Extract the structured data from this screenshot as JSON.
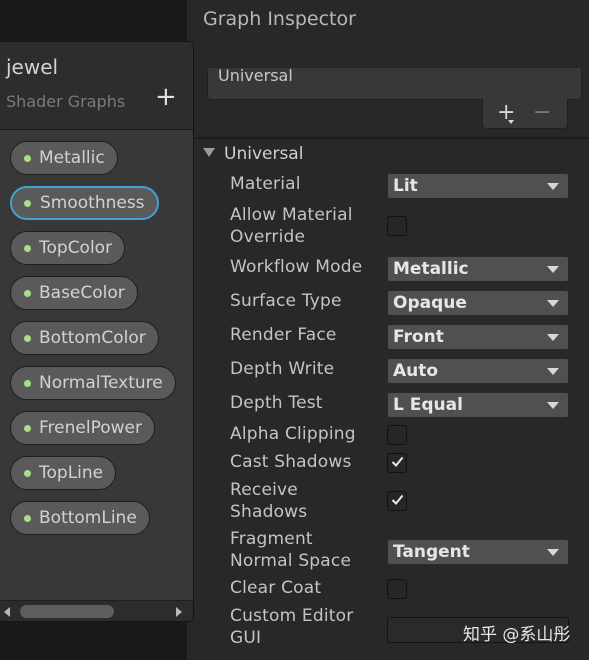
{
  "inspector": {
    "title": "Graph Inspector",
    "active_target": "Universal",
    "add_symbol": "+",
    "remove_symbol": "−",
    "section_title": "Universal",
    "labels": {
      "material": "Material",
      "allow_override_1": "Allow Material",
      "allow_override_2": "Override",
      "workflow_mode": "Workflow Mode",
      "surface_type": "Surface Type",
      "render_face": "Render Face",
      "depth_write": "Depth Write",
      "depth_test": "Depth Test",
      "alpha_clipping": "Alpha Clipping",
      "cast_shadows": "Cast Shadows",
      "receive_shadows_1": "Receive",
      "receive_shadows_2": "Shadows",
      "normal_space_1": "Fragment",
      "normal_space_2": "Normal Space",
      "clear_coat": "Clear Coat",
      "custom_gui_1": "Custom Editor",
      "custom_gui_2": "GUI"
    },
    "values": {
      "material": "Lit",
      "workflow_mode": "Metallic",
      "surface_type": "Opaque",
      "render_face": "Front",
      "depth_write": "Auto",
      "depth_test": "L Equal",
      "normal_space": "Tangent",
      "custom_gui": ""
    },
    "checks": {
      "allow_override": false,
      "alpha_clipping": false,
      "cast_shadows": true,
      "receive_shadows": true,
      "clear_coat": false
    }
  },
  "blackboard": {
    "title": "jewel",
    "subtitle": "Shader Graphs",
    "add_symbol": "+",
    "properties": [
      "Metallic",
      "Smoothness",
      "TopColor",
      "BaseColor",
      "BottomColor",
      "NormalTexture",
      "FrenelPower",
      "TopLine",
      "BottomLine"
    ],
    "selected": "Smoothness"
  },
  "watermark": "知乎 @系山彤",
  "colors": {
    "property_dot": "#a7e084",
    "selection_outline": "#44a0d6",
    "panel_bg": "#282828",
    "blackboard_bg": "#383838"
  }
}
